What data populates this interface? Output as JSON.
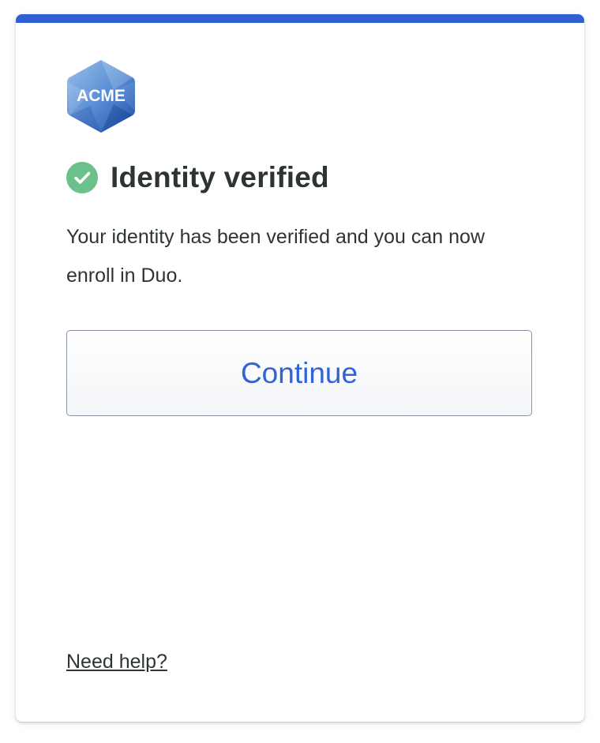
{
  "brand": {
    "logo_text": "ACME",
    "accent_color": "#2f5fd0",
    "logo_icon": "acme-hexagon-logo"
  },
  "status": {
    "icon": "check-circle-icon",
    "icon_color": "#6cc08b",
    "title": "Identity verified"
  },
  "message": {
    "text": "Your identity has been verified and you can now enroll in Duo."
  },
  "actions": {
    "continue_label": "Continue",
    "continue_color": "#2f63d6"
  },
  "footer": {
    "help_label": "Need help?"
  }
}
